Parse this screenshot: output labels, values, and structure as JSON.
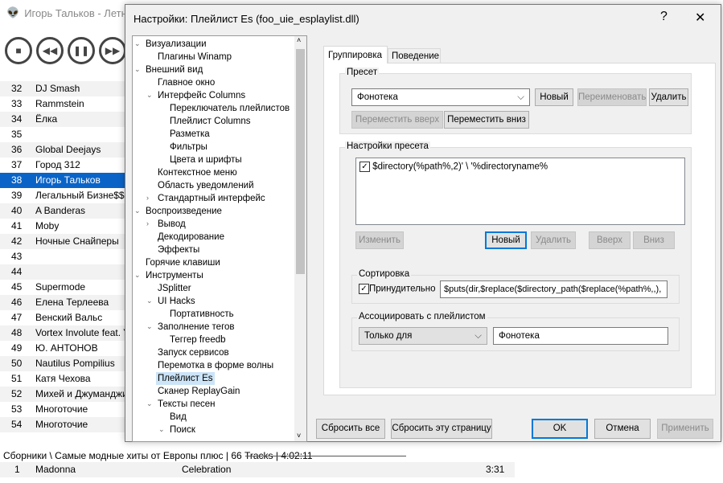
{
  "app": {
    "title": "Игорь Тальков - Летни"
  },
  "tracks": [
    {
      "n": "32",
      "a": "DJ Smash"
    },
    {
      "n": "33",
      "a": "Rammstein"
    },
    {
      "n": "34",
      "a": "Ёлка"
    },
    {
      "n": "35",
      "a": ""
    },
    {
      "n": "36",
      "a": "Global Deejays"
    },
    {
      "n": "37",
      "a": "Город 312"
    },
    {
      "n": "38",
      "a": "Игорь Тальков"
    },
    {
      "n": "39",
      "a": "Легальный Бизне$$"
    },
    {
      "n": "40",
      "a": "A Banderas"
    },
    {
      "n": "41",
      "a": "Moby"
    },
    {
      "n": "42",
      "a": "Ночные Снайперы"
    },
    {
      "n": "43",
      "a": ""
    },
    {
      "n": "44",
      "a": ""
    },
    {
      "n": "45",
      "a": "Supermode"
    },
    {
      "n": "46",
      "a": "Елена Терлеева"
    },
    {
      "n": "47",
      "a": "Венский Вальс"
    },
    {
      "n": "48",
      "a": "Vortex Involute feat. Y"
    },
    {
      "n": "49",
      "a": "Ю. АНТОНОВ"
    },
    {
      "n": "50",
      "a": "Nautilus Pompilius"
    },
    {
      "n": "51",
      "a": "Катя Чехова"
    },
    {
      "n": "52",
      "a": "Михей и Джуманджи"
    },
    {
      "n": "53",
      "a": "Многоточие"
    },
    {
      "n": "54",
      "a": "Многоточие"
    }
  ],
  "group_header": "Сборники \\ Самые модные хиты от Европы плюс | 66 Tracks | 4:02:11",
  "bottom_track": {
    "n": "1",
    "artist": "Madonna",
    "title": "Celebration",
    "time": "3:31"
  },
  "dialog": {
    "title": "Настройки: Плейлист Es (foo_uie_esplaylist.dll)",
    "help": "?",
    "close": "✕",
    "tree": [
      {
        "l": "Визуализации",
        "d": 0,
        "e": "v"
      },
      {
        "l": "Плагины Winamp",
        "d": 1
      },
      {
        "l": "Внешний вид",
        "d": 0,
        "e": "v"
      },
      {
        "l": "Главное окно",
        "d": 1
      },
      {
        "l": "Интерфейс Columns",
        "d": 1,
        "e": "v"
      },
      {
        "l": "Переключатель плейлистов",
        "d": 2
      },
      {
        "l": "Плейлист Columns",
        "d": 2
      },
      {
        "l": "Разметка",
        "d": 2
      },
      {
        "l": "Фильтры",
        "d": 2
      },
      {
        "l": "Цвета и шрифты",
        "d": 2
      },
      {
        "l": "Контекстное меню",
        "d": 1
      },
      {
        "l": "Область уведомлений",
        "d": 1
      },
      {
        "l": "Стандартный интерфейс",
        "d": 1,
        "e": ">"
      },
      {
        "l": "Воспроизведение",
        "d": 0,
        "e": "v"
      },
      {
        "l": "Вывод",
        "d": 1,
        "e": ">"
      },
      {
        "l": "Декодирование",
        "d": 1
      },
      {
        "l": "Эффекты",
        "d": 1
      },
      {
        "l": "Горячие клавиши",
        "d": 0
      },
      {
        "l": "Инструменты",
        "d": 0,
        "e": "v"
      },
      {
        "l": "JSplitter",
        "d": 1
      },
      {
        "l": "UI Hacks",
        "d": 1,
        "e": "v"
      },
      {
        "l": "Портативность",
        "d": 2
      },
      {
        "l": "Заполнение тегов",
        "d": 1,
        "e": "v"
      },
      {
        "l": "Теггер freedb",
        "d": 2
      },
      {
        "l": "Запуск сервисов",
        "d": 1
      },
      {
        "l": "Перемотка в форме волны",
        "d": 1
      },
      {
        "l": "Плейлист Es",
        "d": 1,
        "sel": true
      },
      {
        "l": "Сканер ReplayGain",
        "d": 1
      },
      {
        "l": "Тексты песен",
        "d": 1,
        "e": "v"
      },
      {
        "l": "Вид",
        "d": 2
      },
      {
        "l": "Поиск",
        "d": 2,
        "e": "v"
      }
    ],
    "tabs": [
      "Группировка",
      "Поведение"
    ],
    "preset": {
      "label": "Пресет",
      "value": "Фонотека",
      "new": "Новый",
      "rename": "Переименовать",
      "delete": "Удалить",
      "move_up": "Переместить вверх",
      "move_down": "Переместить вниз"
    },
    "preset_settings": {
      "label": "Настройки пресета",
      "item": "$directory(%path%,2)' \\ '%directoryname%",
      "edit": "Изменить",
      "new": "Новый",
      "delete": "Удалить",
      "up": "Вверх",
      "down": "Вниз"
    },
    "sort": {
      "label": "Сортировка",
      "force": "Принудительно",
      "value": "$puts(dir,$replace($directory_path($replace(%path%,,),"
    },
    "assoc": {
      "label": "Ассоциировать с плейлистом",
      "mode": "Только для",
      "value": "Фонотека"
    },
    "reset_all": "Сбросить все",
    "reset_page": "Сбросить эту страницу",
    "ok": "OK",
    "cancel": "Отмена",
    "apply": "Применить"
  }
}
